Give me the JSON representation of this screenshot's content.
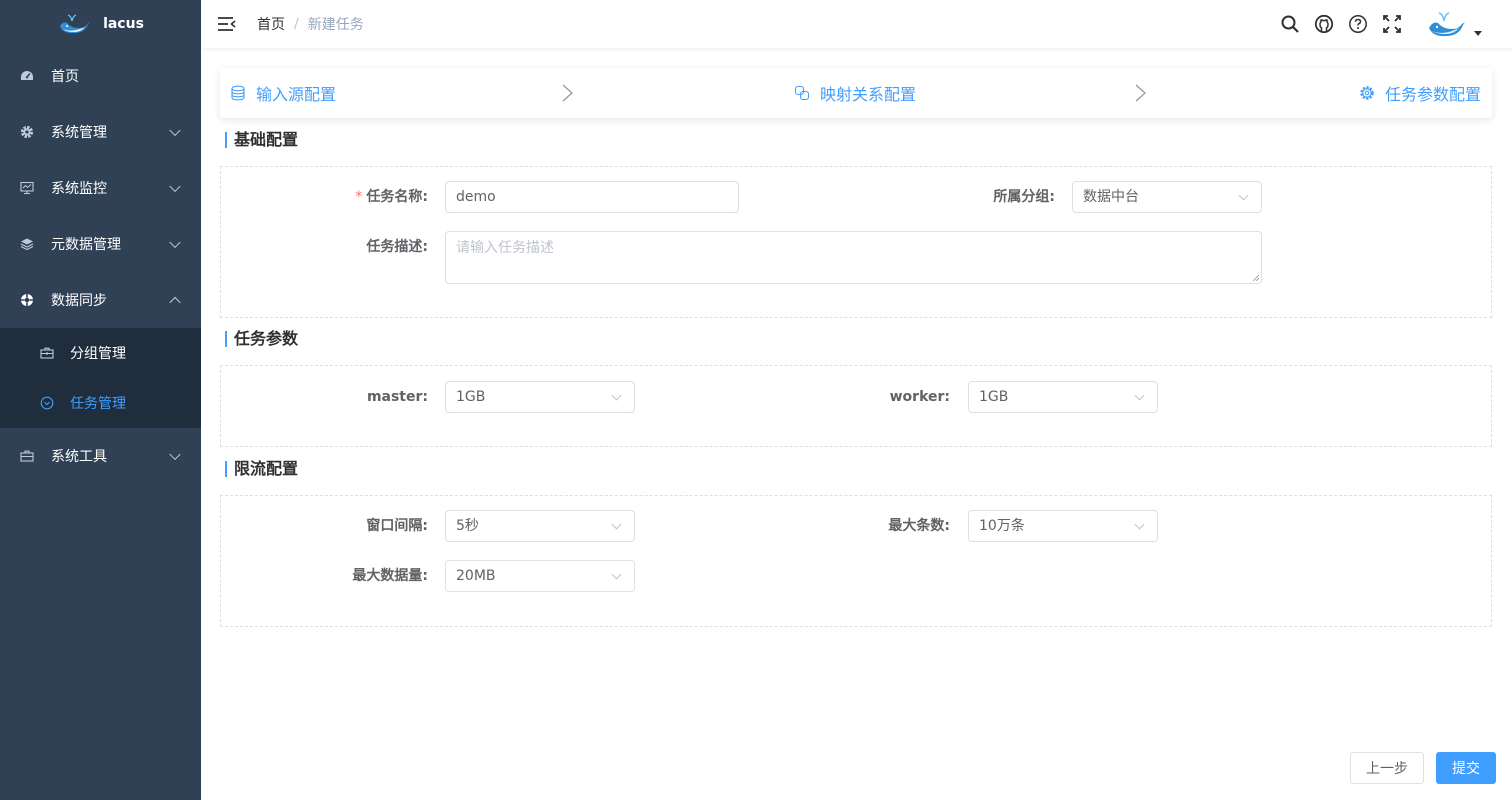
{
  "app": {
    "name": "lacus"
  },
  "sidebar": {
    "items": [
      {
        "label": "首页",
        "icon": "dashboard-icon"
      },
      {
        "label": "系统管理",
        "icon": "gear-icon"
      },
      {
        "label": "系统监控",
        "icon": "monitor-icon"
      },
      {
        "label": "元数据管理",
        "icon": "layers-icon"
      },
      {
        "label": "数据同步",
        "icon": "sync-icon",
        "expanded": true
      },
      {
        "label": "系统工具",
        "icon": "toolbox-icon"
      }
    ],
    "sub_items": [
      {
        "label": "分组管理",
        "icon": "briefcase-icon"
      },
      {
        "label": "任务管理",
        "icon": "circle-check-icon",
        "active": true
      }
    ]
  },
  "breadcrumb": {
    "home": "首页",
    "separator": "/",
    "current": "新建任务"
  },
  "steps": [
    {
      "label": "输入源配置",
      "icon": "database-icon"
    },
    {
      "label": "映射关系配置",
      "icon": "link-icon"
    },
    {
      "label": "任务参数配置",
      "icon": "settings-icon"
    }
  ],
  "sections": {
    "basic": {
      "title": "基础配置",
      "task_name_label": "任务名称:",
      "task_name_value": "demo",
      "group_label": "所属分组:",
      "group_value": "数据中台",
      "desc_label": "任务描述:",
      "desc_placeholder": "请输入任务描述"
    },
    "params": {
      "title": "任务参数",
      "master_label": "master:",
      "master_value": "1GB",
      "worker_label": "worker:",
      "worker_value": "1GB"
    },
    "limit": {
      "title": "限流配置",
      "window_label": "窗口间隔:",
      "window_value": "5秒",
      "max_rows_label": "最大条数:",
      "max_rows_value": "10万条",
      "max_size_label": "最大数据量:",
      "max_size_value": "20MB"
    }
  },
  "buttons": {
    "prev": "上一步",
    "submit": "提交"
  },
  "colors": {
    "sidebar_bg": "#304156",
    "submenu_bg": "#1f2d3d",
    "accent": "#409eff",
    "required": "#f56c6c"
  }
}
